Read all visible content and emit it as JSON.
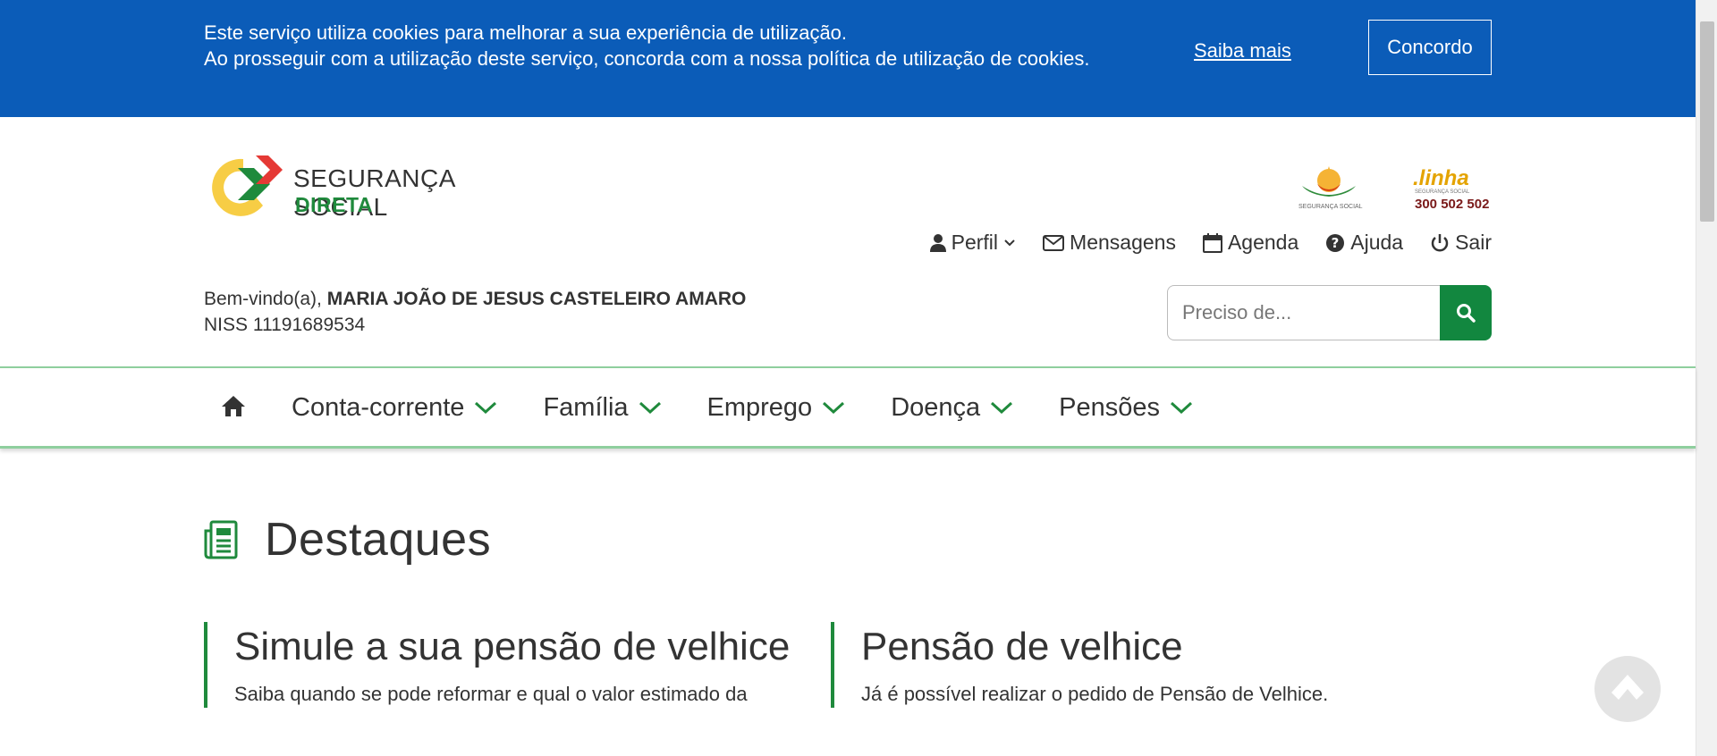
{
  "cookie_banner": {
    "line1": "Este serviço utiliza cookies para melhorar a sua experiência de utilização.",
    "line2": "Ao prosseguir com a utilização deste serviço, concorda com a nossa política de utilização de cookies.",
    "more_link": "Saiba mais",
    "accept_button": "Concordo"
  },
  "header": {
    "logo_line1": "SEGURANÇA SOCIAL",
    "logo_line2": "DIRETA",
    "partner_logo1_caption": "SEGURANÇA SOCIAL",
    "partner_logo2": {
      "word": ".linha",
      "caption": "SEGURANÇA SOCIAL",
      "number": "300 502 502"
    },
    "top_nav": [
      {
        "label": "Perfil",
        "icon": "user-icon"
      },
      {
        "label": "Mensagens",
        "icon": "envelope-icon"
      },
      {
        "label": "Agenda",
        "icon": "calendar-icon"
      },
      {
        "label": "Ajuda",
        "icon": "question-circle-icon"
      },
      {
        "label": "Sair",
        "icon": "power-icon"
      }
    ],
    "welcome_prefix": "Bem-vindo(a), ",
    "user_name": "MARIA JOÃO DE JESUS CASTELEIRO AMARO",
    "niss": "NISS 11191689534",
    "search_placeholder": "Preciso de..."
  },
  "main_nav": {
    "items": [
      {
        "label": "Conta-corrente"
      },
      {
        "label": "Família"
      },
      {
        "label": "Emprego"
      },
      {
        "label": "Doença"
      },
      {
        "label": "Pensões"
      }
    ]
  },
  "content": {
    "section_title": "Destaques",
    "cards": [
      {
        "title": "Simule a sua pensão de velhice",
        "text": "Saiba quando se pode reformar e qual o valor estimado da"
      },
      {
        "title": "Pensão de velhice",
        "text": "Já é possível realizar o pedido de Pensão de Velhice."
      }
    ]
  },
  "colors": {
    "banner_blue": "#0b5cb8",
    "accent_green": "#12873f",
    "nav_border_green": "#8fcf9e"
  }
}
